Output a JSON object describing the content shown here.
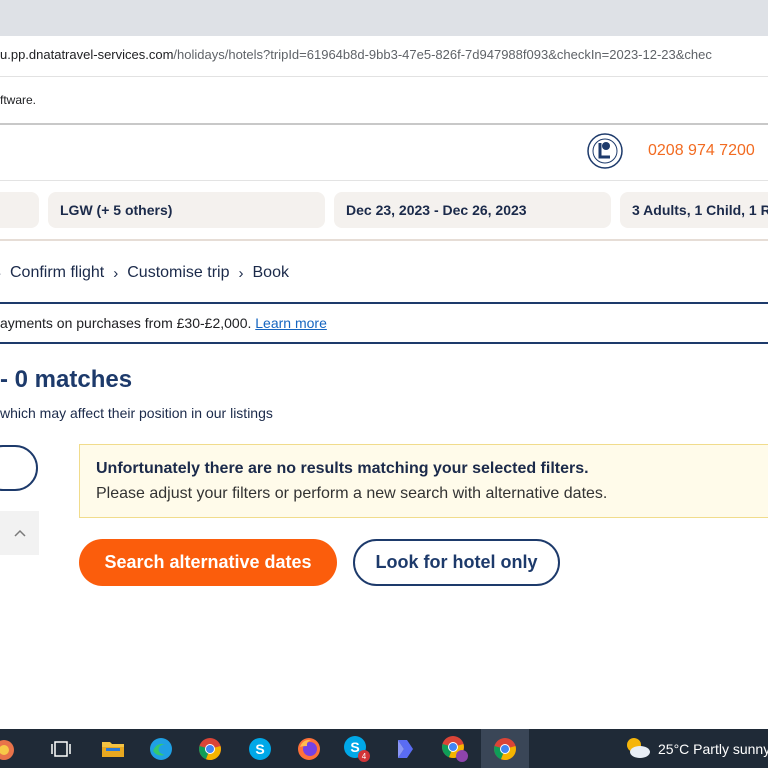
{
  "browser": {
    "url_host": "u.pp.dnatatravel-services.com",
    "url_path": "/holidays/hotels?tripId=61964b8d-9bb3-47e5-826f-7d947988f093&checkIn=2023-12-23&chec",
    "info_text": "ftware."
  },
  "header": {
    "phone": "0208 974 7200"
  },
  "search": {
    "airports": "LGW (+ 5 others)",
    "dates": "Dec 23, 2023 - Dec 26, 2023",
    "travellers": "3 Adults, 1 Child, 1 Ro"
  },
  "breadcrumb": {
    "items": [
      "Confirm flight",
      "Customise trip",
      "Book"
    ],
    "separator": "›"
  },
  "promo": {
    "text": "ayments on purchases from £30-£2,000. ",
    "link": "Learn more"
  },
  "results": {
    "title": "- 0 matches",
    "subtitle": " which may affect their position in our listings"
  },
  "message": {
    "title": "Unfortunately there are no results matching your selected filters.",
    "body": "Please adjust your filters or perform a new search with alternative dates."
  },
  "actions": {
    "alternative_dates": "Search alternative dates",
    "hotel_only": "Look for hotel only"
  },
  "taskbar": {
    "icons": [
      "task-view-icon",
      "file-explorer-icon",
      "edge-icon",
      "chrome-icon",
      "skype-icon",
      "firefox-icon",
      "skype-notification-icon",
      "power-automate-icon",
      "chrome-profile-icon",
      "chrome-active-icon"
    ],
    "weather": "25°C  Partly sunny"
  },
  "colors": {
    "brand_orange": "#fb5d0c",
    "brand_navy": "#1d3a6b",
    "phone_orange": "#f26b21"
  }
}
